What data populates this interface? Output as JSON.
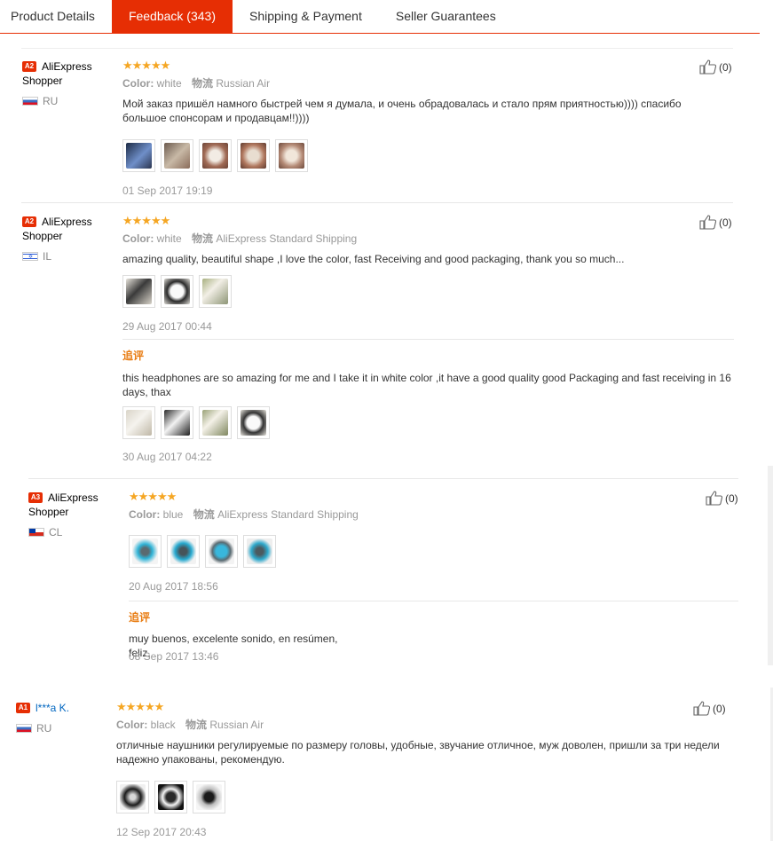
{
  "tabs": [
    {
      "label": "Product Details"
    },
    {
      "label": "Feedback (343)"
    },
    {
      "label": "Shipping & Payment"
    },
    {
      "label": "Seller Guarantees"
    }
  ],
  "followup_label": "追评",
  "color_label": "Color:",
  "ship_label": "物流",
  "stars": "★★★★★",
  "reviews": [
    {
      "badge": "A2",
      "name": "AliExpress Shopper",
      "country": "RU",
      "color": "white",
      "shipping": "Russian Air",
      "text": "Мой заказ пришёл намного быстрей чем я думала, и очень обрадовалась и стало прям приятностью)))) спасибо большое спонсорам и продавцам!!))))",
      "date": "01 Sep 2017 19:19",
      "helpful": "(0)"
    },
    {
      "badge": "A2",
      "name": "AliExpress Shopper",
      "country": "IL",
      "color": "white",
      "shipping": "AliExpress Standard Shipping",
      "text": "amazing quality, beautiful shape ,I love the color, fast Receiving and good packaging, thank you so much...",
      "date": "29 Aug 2017 00:44",
      "followup_text": "this headphones are so amazing for me and I take it in white color ,it have a good quality good Packaging and fast receiving in 16 days, thax",
      "followup_date": "30 Aug 2017 04:22",
      "helpful": "(0)"
    },
    {
      "badge": "A3",
      "name": "AliExpress Shopper",
      "country": "CL",
      "color": "blue",
      "shipping": "AliExpress Standard Shipping",
      "date": "20 Aug 2017 18:56",
      "followup_text": "muy buenos, excelente sonido, en resúmen, feliz.",
      "followup_date": "08 Sep 2017 13:46",
      "helpful": "(0)"
    },
    {
      "badge": "A1",
      "name": "l***a K.",
      "country": "RU",
      "color": "black",
      "shipping": "Russian Air",
      "text": "отличные наушники регулируемые по размеру головы, удобные, звучание отличное, муж доволен, пришли за три недели надежно упакованы, рекомендую.",
      "date": "12 Sep 2017 20:43",
      "helpful": "(0)"
    }
  ]
}
